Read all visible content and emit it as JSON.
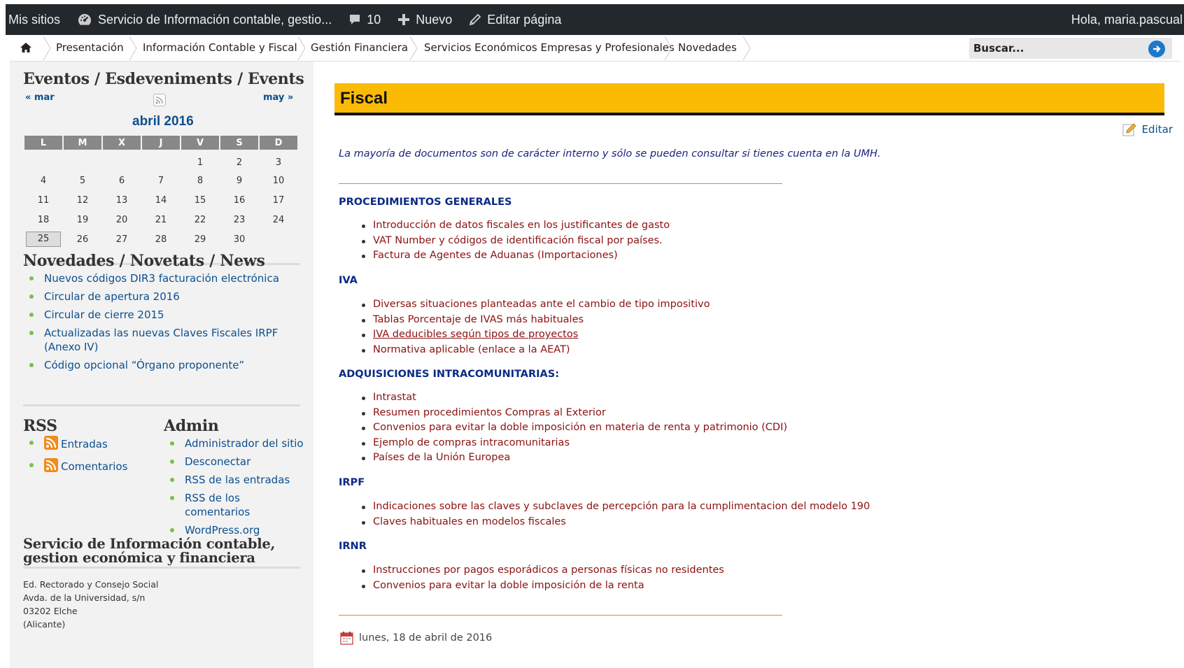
{
  "admin_bar": {
    "my_sites": "Mis sitios",
    "site_name": "Servicio de Información contable, gestio...",
    "comments_count": "10",
    "new_label": "Nuevo",
    "edit_page": "Editar página",
    "greeting": "Hola, maria.pascual",
    "bg_color": "#23282d"
  },
  "nav": {
    "items": [
      {
        "label": "Presentación"
      },
      {
        "label": "Información Contable y Fiscal"
      },
      {
        "label": "Gestión Financiera"
      },
      {
        "label": "Servicios Económicos Empresas y Profesionales"
      },
      {
        "label": "Novedades"
      }
    ],
    "search_placeholder": "Buscar..."
  },
  "sidebar": {
    "events": {
      "title": "Eventos / Esdeveniments / Events",
      "prev": "« mar",
      "next": "may »",
      "month": "abril 2016",
      "weekdays": [
        "L",
        "M",
        "X",
        "J",
        "V",
        "S",
        "D"
      ],
      "weeks": [
        [
          "",
          "",
          "",
          "",
          "1",
          "2",
          "3"
        ],
        [
          "4",
          "5",
          "6",
          "7",
          "8",
          "9",
          "10"
        ],
        [
          "11",
          "12",
          "13",
          "14",
          "15",
          "16",
          "17"
        ],
        [
          "18",
          "19",
          "20",
          "21",
          "22",
          "23",
          "24"
        ],
        [
          "25",
          "26",
          "27",
          "28",
          "29",
          "30",
          ""
        ]
      ],
      "today": "25"
    },
    "news": {
      "title": "Novedades / Novetats / News",
      "items": [
        "Nuevos códigos DIR3 facturación electrónica",
        "Circular de apertura 2016",
        "Circular de cierre 2015",
        "Actualizadas las nuevas Claves Fiscales IRPF (Anexo IV)",
        "Código opcional “Órgano proponente”"
      ]
    },
    "rss": {
      "title": "RSS",
      "items": [
        "Entradas",
        "Comentarios"
      ]
    },
    "admin": {
      "title": "Admin",
      "items": [
        "Administrador del sitio",
        "Desconectar",
        "RSS de las entradas",
        "RSS de los comentarios",
        "WordPress.org"
      ]
    },
    "footer": {
      "title_line1": "Servicio de Información contable,",
      "title_line2": "gestion económica y financiera",
      "addr1": "Ed. Rectorado y Consejo Social",
      "addr2": "Avda. de la Universidad, s/n",
      "addr3": "03202 Elche",
      "addr4": "(Alicante)"
    }
  },
  "main": {
    "title": "Fiscal",
    "title_bg": "#fbbb05",
    "edit_label": "Editar",
    "notice": "La mayoría de documentos son de carácter interno y sólo se pueden consultar si tienes cuenta en la UMH.",
    "sections": [
      {
        "heading": "PROCEDIMIENTOS GENERALES",
        "items": [
          "Introducción de datos fiscales en los justificantes de gasto",
          "VAT Number y códigos de identificación fiscal por países.",
          "Factura de Agentes de Aduanas (Importaciones)"
        ]
      },
      {
        "heading": "IVA",
        "items": [
          "Diversas situaciones planteadas ante el cambio de tipo impositivo",
          "Tablas Porcentaje de IVAS más habituales",
          "IVA deducibles según tipos de proyectos",
          "Normativa aplicable (enlace a la AEAT)"
        ]
      },
      {
        "heading": "ADQUISICIONES INTRACOMUNITARIAS:",
        "items": [
          "Intrastat",
          "Resumen procedimientos Compras al Exterior",
          "Convenios para evitar la doble imposición en materia de renta y patrimonio (CDI)",
          "Ejemplo de compras intracomunitarias",
          "Países de la Unión Europea"
        ]
      },
      {
        "heading": "IRPF",
        "items": [
          "Indicaciones sobre las claves y subclaves de percepción para la cumplimentacion del modelo 190",
          "Claves habituales en modelos fiscales"
        ]
      },
      {
        "heading": "IRNR",
        "items": [
          "Instrucciones por pagos esporádicos a personas físicas no residentes",
          "Convenios para evitar la doble imposición de la renta"
        ]
      }
    ],
    "date": "lunes, 18 de abril de 2016"
  }
}
